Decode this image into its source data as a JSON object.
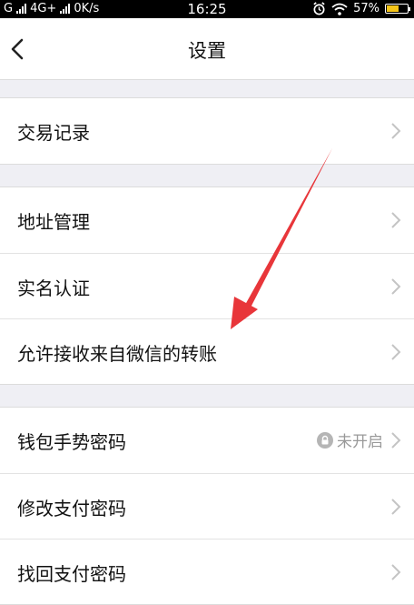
{
  "status_bar": {
    "carrier_1": "G",
    "network": "4G+",
    "speed": "0K/s",
    "time": "16:25",
    "battery": "57%",
    "battery_level": 0.57
  },
  "nav": {
    "title": "设置"
  },
  "groups": [
    [
      {
        "label": "交易记录"
      }
    ],
    [
      {
        "label": "地址管理"
      },
      {
        "label": "实名认证"
      },
      {
        "label": "允许接收来自微信的转账"
      }
    ],
    [
      {
        "label": "钱包手势密码",
        "status": "未开启"
      },
      {
        "label": "修改支付密码"
      },
      {
        "label": "找回支付密码"
      }
    ]
  ],
  "icons": {
    "back": "chevron-left-icon",
    "chevron": "chevron-right-icon",
    "lock": "lock-icon",
    "alarm": "alarm-icon",
    "wifi": "wifi-icon"
  },
  "colors": {
    "annotation_arrow": "#e8363a",
    "background": "#efeff4"
  }
}
